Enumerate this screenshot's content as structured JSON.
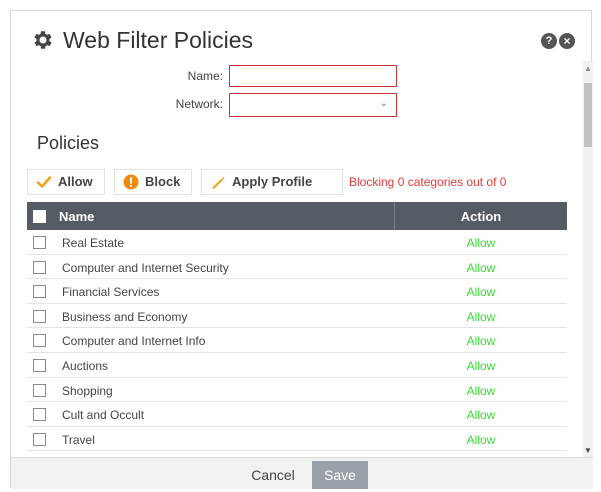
{
  "dialog": {
    "title": "Web Filter Policies",
    "help_icon": "help-icon",
    "close_icon": "close-icon"
  },
  "form": {
    "name_label": "Name:",
    "name_value": "",
    "network_label": "Network:",
    "network_value": ""
  },
  "policies": {
    "section_title": "Policies",
    "toolbar": {
      "allow_label": "Allow",
      "block_label": "Block",
      "apply_profile_label": "Apply Profile",
      "status_text": "Blocking 0 categories out of 0"
    },
    "columns": {
      "name": "Name",
      "action": "Action"
    },
    "rows": [
      {
        "name": "Real Estate",
        "action": "Allow"
      },
      {
        "name": "Computer and Internet Security",
        "action": "Allow"
      },
      {
        "name": "Financial Services",
        "action": "Allow"
      },
      {
        "name": "Business and Economy",
        "action": "Allow"
      },
      {
        "name": "Computer and Internet Info",
        "action": "Allow"
      },
      {
        "name": "Auctions",
        "action": "Allow"
      },
      {
        "name": "Shopping",
        "action": "Allow"
      },
      {
        "name": "Cult and Occult",
        "action": "Allow"
      },
      {
        "name": "Travel",
        "action": "Allow"
      }
    ]
  },
  "footer": {
    "cancel_label": "Cancel",
    "save_label": "Save"
  },
  "colors": {
    "allow_green": "#33dd33",
    "warning_red": "#e23a3a",
    "header_bg": "#555b63",
    "allow_icon": "#f0a020",
    "block_icon": "#f08a10"
  }
}
